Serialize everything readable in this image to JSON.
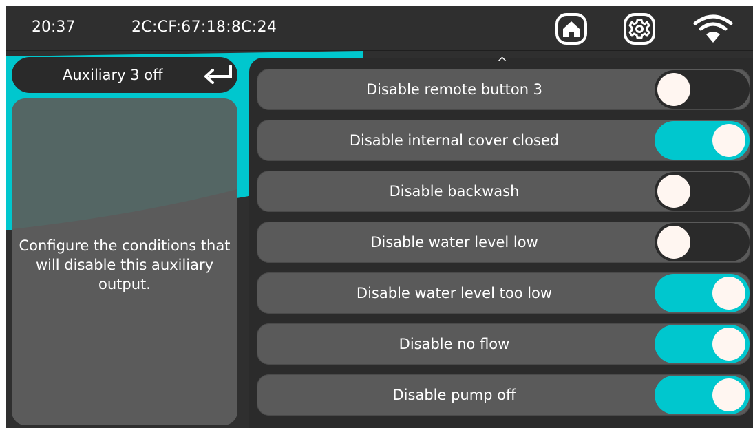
{
  "status_bar": {
    "time": "20:37",
    "mac_address": "2C:CF:67:18:8C:24",
    "icons": [
      "home-icon",
      "settings-gear-icon",
      "wifi-icon"
    ]
  },
  "header": {
    "title": "Auxiliary 3 off",
    "back_icon": "return-arrow-icon"
  },
  "info": {
    "text": "Configure the conditions that will disable this auxiliary output."
  },
  "list": {
    "scroll_up_icon": "^",
    "items": [
      {
        "label": "Disable remote button 3",
        "enabled": false
      },
      {
        "label": "Disable internal cover closed",
        "enabled": true
      },
      {
        "label": "Disable backwash",
        "enabled": false
      },
      {
        "label": "Disable water level low",
        "enabled": false
      },
      {
        "label": "Disable water level too low",
        "enabled": true
      },
      {
        "label": "Disable no flow",
        "enabled": true
      },
      {
        "label": "Disable pump off",
        "enabled": true
      }
    ]
  },
  "colors": {
    "accent": "#00c7ce",
    "background": "#2f2f2f",
    "row": "#5a5a5a",
    "toggle_off": "#2a2a2a"
  }
}
